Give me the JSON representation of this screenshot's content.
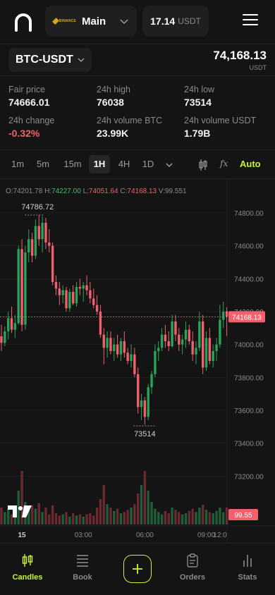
{
  "header": {
    "account": {
      "exchange_logo_text": "BINANCE",
      "name": "Main"
    },
    "balance": {
      "value": "17.14",
      "unit": "USDT"
    }
  },
  "pair": {
    "symbol": "BTC-USDT",
    "last_price": "74,168.13",
    "last_unit": "USDT"
  },
  "stats": [
    {
      "label": "Fair price",
      "value": "74666.01",
      "tone": "neutral"
    },
    {
      "label": "24h high",
      "value": "76038",
      "tone": "neutral"
    },
    {
      "label": "24h low",
      "value": "73514",
      "tone": "neutral"
    },
    {
      "label": "24h change",
      "value": "-0.32%",
      "tone": "negative"
    },
    {
      "label": "24h volume BTC",
      "value": "23.99K",
      "tone": "neutral"
    },
    {
      "label": "24h volume USDT",
      "value": "1.79B",
      "tone": "neutral"
    }
  ],
  "intervals": {
    "options": [
      "1m",
      "5m",
      "15m",
      "1H",
      "4H",
      "1D"
    ],
    "selected": "1H",
    "fx_label": "fx",
    "auto_label": "Auto"
  },
  "ohlc_legend": {
    "o_label": "O:",
    "o": "74201.78",
    "h_label": "H:",
    "h": "74227.00",
    "l_label": "L:",
    "l": "74051.64",
    "c_label": "C:",
    "c": "74168.13",
    "v_label": "V:",
    "v": "99.551"
  },
  "chart_data": {
    "type": "candlestick",
    "colors": {
      "up": "#2aa35a",
      "down": "#f0616d",
      "background": "#141414",
      "grid": "#1d1d1d",
      "last_price_line": "#f0616d"
    },
    "price_axis": {
      "ticks": [
        74800,
        74600,
        74400,
        74200,
        74000,
        73800,
        73600,
        73400,
        73200
      ],
      "range": [
        73120,
        74920
      ]
    },
    "time_axis": {
      "ticks": [
        "15",
        "03:00",
        "06:00",
        "09:00",
        "12:0"
      ],
      "tick_indices": [
        6,
        24,
        42,
        60,
        78
      ]
    },
    "last_price_label": "74168.13",
    "last_volume_label": "99.55",
    "high_marker": "74786.72",
    "low_marker": "73514",
    "candles": [
      {
        "o": 74050,
        "h": 74120,
        "l": 73960,
        "c": 74010
      },
      {
        "o": 74010,
        "h": 74110,
        "l": 73990,
        "c": 74080
      },
      {
        "o": 74080,
        "h": 74200,
        "l": 74030,
        "c": 74160
      },
      {
        "o": 74160,
        "h": 74230,
        "l": 74070,
        "c": 74090
      },
      {
        "o": 74090,
        "h": 74180,
        "l": 74040,
        "c": 74130
      },
      {
        "o": 74130,
        "h": 74600,
        "l": 74120,
        "c": 74580
      },
      {
        "o": 74580,
        "h": 74640,
        "l": 74080,
        "c": 74120
      },
      {
        "o": 74120,
        "h": 74600,
        "l": 74090,
        "c": 74560
      },
      {
        "o": 74560,
        "h": 74700,
        "l": 74500,
        "c": 74640
      },
      {
        "o": 74640,
        "h": 74680,
        "l": 74500,
        "c": 74540
      },
      {
        "o": 74540,
        "h": 74760,
        "l": 74520,
        "c": 74720
      },
      {
        "o": 74720,
        "h": 74787,
        "l": 74600,
        "c": 74640
      },
      {
        "o": 74640,
        "h": 74780,
        "l": 74560,
        "c": 74740
      },
      {
        "o": 74740,
        "h": 74770,
        "l": 74580,
        "c": 74620
      },
      {
        "o": 74620,
        "h": 74700,
        "l": 74560,
        "c": 74600
      },
      {
        "o": 74600,
        "h": 74620,
        "l": 74360,
        "c": 74380
      },
      {
        "o": 74380,
        "h": 74420,
        "l": 74300,
        "c": 74340
      },
      {
        "o": 74340,
        "h": 74380,
        "l": 74240,
        "c": 74300
      },
      {
        "o": 74300,
        "h": 74360,
        "l": 74250,
        "c": 74330
      },
      {
        "o": 74330,
        "h": 74350,
        "l": 74200,
        "c": 74220
      },
      {
        "o": 74220,
        "h": 74340,
        "l": 74200,
        "c": 74320
      },
      {
        "o": 74320,
        "h": 74360,
        "l": 74240,
        "c": 74250
      },
      {
        "o": 74250,
        "h": 74380,
        "l": 74230,
        "c": 74350
      },
      {
        "o": 74350,
        "h": 74400,
        "l": 74300,
        "c": 74340
      },
      {
        "o": 74340,
        "h": 74380,
        "l": 74260,
        "c": 74360
      },
      {
        "o": 74360,
        "h": 74420,
        "l": 74300,
        "c": 74330
      },
      {
        "o": 74330,
        "h": 74380,
        "l": 74250,
        "c": 74280
      },
      {
        "o": 74280,
        "h": 74340,
        "l": 74220,
        "c": 74240
      },
      {
        "o": 74240,
        "h": 74300,
        "l": 74180,
        "c": 74200
      },
      {
        "o": 74200,
        "h": 74240,
        "l": 74040,
        "c": 74060
      },
      {
        "o": 74060,
        "h": 74100,
        "l": 73880,
        "c": 73980
      },
      {
        "o": 73980,
        "h": 74080,
        "l": 73920,
        "c": 74040
      },
      {
        "o": 74040,
        "h": 74080,
        "l": 73940,
        "c": 73960
      },
      {
        "o": 73960,
        "h": 74040,
        "l": 73900,
        "c": 74000
      },
      {
        "o": 74000,
        "h": 74060,
        "l": 73920,
        "c": 73940
      },
      {
        "o": 73940,
        "h": 74040,
        "l": 73900,
        "c": 74020
      },
      {
        "o": 74020,
        "h": 74080,
        "l": 73920,
        "c": 73950
      },
      {
        "o": 73950,
        "h": 73980,
        "l": 73880,
        "c": 73900
      },
      {
        "o": 73900,
        "h": 74000,
        "l": 73860,
        "c": 73940
      },
      {
        "o": 73940,
        "h": 73980,
        "l": 73800,
        "c": 73820
      },
      {
        "o": 73820,
        "h": 73860,
        "l": 73580,
        "c": 73620
      },
      {
        "o": 73620,
        "h": 73700,
        "l": 73540,
        "c": 73660
      },
      {
        "o": 73660,
        "h": 73680,
        "l": 73514,
        "c": 73560
      },
      {
        "o": 73560,
        "h": 73760,
        "l": 73540,
        "c": 73740
      },
      {
        "o": 73740,
        "h": 73840,
        "l": 73700,
        "c": 73820
      },
      {
        "o": 73820,
        "h": 74000,
        "l": 73800,
        "c": 73960
      },
      {
        "o": 73960,
        "h": 74020,
        "l": 73900,
        "c": 73980
      },
      {
        "o": 73980,
        "h": 74100,
        "l": 73960,
        "c": 74060
      },
      {
        "o": 74060,
        "h": 74120,
        "l": 73980,
        "c": 74020
      },
      {
        "o": 74020,
        "h": 74080,
        "l": 73960,
        "c": 73990
      },
      {
        "o": 73990,
        "h": 74180,
        "l": 73980,
        "c": 74140
      },
      {
        "o": 74140,
        "h": 74180,
        "l": 74020,
        "c": 74060
      },
      {
        "o": 74060,
        "h": 74100,
        "l": 73960,
        "c": 74000
      },
      {
        "o": 74000,
        "h": 74060,
        "l": 73940,
        "c": 74030
      },
      {
        "o": 74030,
        "h": 74140,
        "l": 73980,
        "c": 74090
      },
      {
        "o": 74090,
        "h": 74120,
        "l": 74000,
        "c": 74020
      },
      {
        "o": 74020,
        "h": 74080,
        "l": 73900,
        "c": 73940
      },
      {
        "o": 73940,
        "h": 74020,
        "l": 73880,
        "c": 73980
      },
      {
        "o": 73980,
        "h": 74200,
        "l": 73960,
        "c": 74140
      },
      {
        "o": 74140,
        "h": 74180,
        "l": 73820,
        "c": 73860
      },
      {
        "o": 73860,
        "h": 74080,
        "l": 73840,
        "c": 74040
      },
      {
        "o": 74040,
        "h": 74100,
        "l": 73880,
        "c": 73900
      },
      {
        "o": 73900,
        "h": 74000,
        "l": 73860,
        "c": 73960
      },
      {
        "o": 73960,
        "h": 74040,
        "l": 73900,
        "c": 74000
      },
      {
        "o": 74000,
        "h": 74240,
        "l": 73980,
        "c": 74150
      },
      {
        "o": 74150,
        "h": 74260,
        "l": 74100,
        "c": 74200
      },
      {
        "o": 74201.78,
        "h": 74227,
        "l": 74051.64,
        "c": 74168.13
      }
    ],
    "volumes": [
      30,
      22,
      28,
      18,
      25,
      60,
      95,
      40,
      26,
      34,
      28,
      38,
      22,
      30,
      18,
      34,
      20,
      16,
      18,
      22,
      14,
      20,
      16,
      18,
      14,
      18,
      20,
      16,
      30,
      45,
      70,
      36,
      30,
      24,
      28,
      20,
      22,
      26,
      30,
      36,
      55,
      70,
      95,
      60,
      40,
      28,
      22,
      18,
      24,
      20,
      30,
      26,
      22,
      18,
      20,
      24,
      28,
      22,
      30,
      35,
      26,
      22,
      20,
      24,
      30,
      22,
      30
    ],
    "volume_max": 100
  },
  "nav": {
    "items": [
      {
        "key": "candles",
        "label": "Candles",
        "active": true
      },
      {
        "key": "book",
        "label": "Book",
        "active": false
      },
      {
        "key": "trade",
        "label": "",
        "active": false
      },
      {
        "key": "orders",
        "label": "Orders",
        "active": false
      },
      {
        "key": "stats",
        "label": "Stats",
        "active": false
      }
    ]
  }
}
